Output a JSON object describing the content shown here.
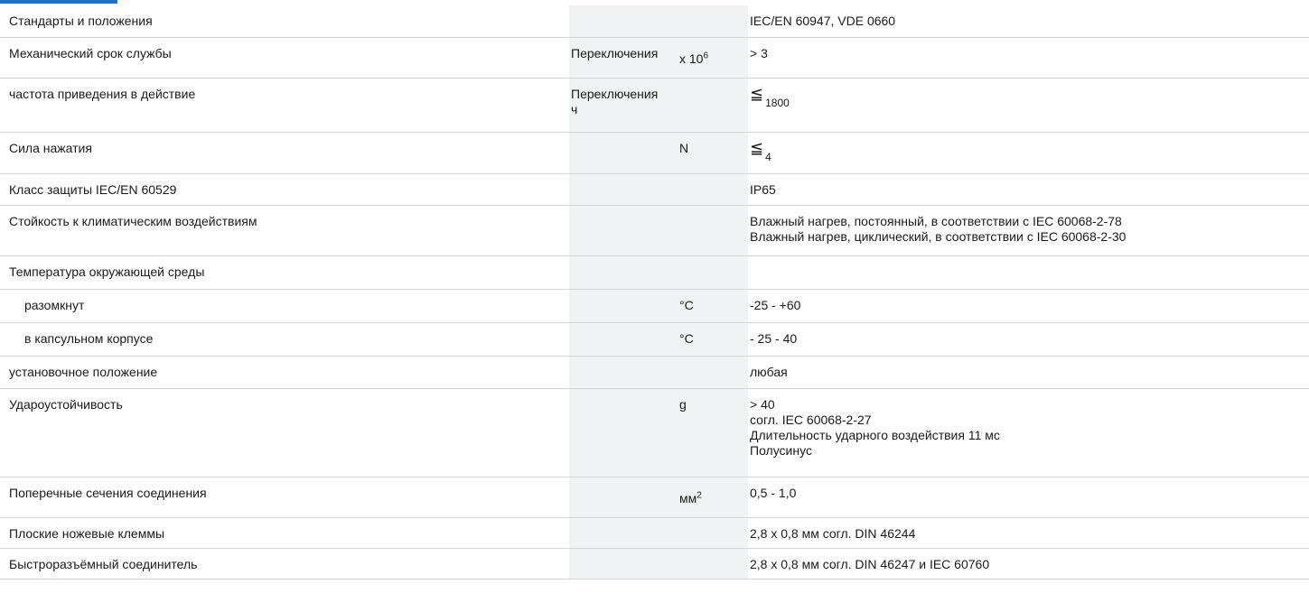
{
  "rows": [
    {
      "label": "Стандарты и положения",
      "value": "IEC/EN 60947, VDE 0660"
    },
    {
      "label": "Механический срок службы",
      "unit1": "Переключения",
      "unit2_base": "x 10",
      "unit2_exp": "6",
      "value": "> 3"
    },
    {
      "label": "частота приведения в действие",
      "unit1_a": "Переключения",
      "unit1_b": "ч",
      "value_symbol": "≦",
      "value": "1800"
    },
    {
      "label": "Сила нажатия",
      "unit2": "N",
      "value_symbol": "≦",
      "value": "4"
    },
    {
      "label": "Класс защиты IEC/EN 60529",
      "value": "IP65"
    },
    {
      "label": "Стойкость к климатическим воздействиям",
      "values": [
        "Влажный нагрев, постоянный, в соответствии с IEC 60068-2-78",
        "Влажный нагрев, циклический, в соответствии с IEC 60068-2-30"
      ]
    },
    {
      "label": "Температура окружающей среды"
    },
    {
      "label": "разомкнут",
      "unit2": "°C",
      "value": "-25 - +60"
    },
    {
      "label": "в капсульном корпусе",
      "unit2": "°C",
      "value": "- 25 - 40"
    },
    {
      "label": "установочное положение",
      "value": "любая"
    },
    {
      "label": "Удароустойчивость",
      "unit2": "g",
      "values": [
        "> 40",
        "согл. IEC 60068-2-27",
        "Длительность ударного воздействия 11 мс",
        "Полусинус"
      ]
    },
    {
      "label": "Поперечные сечения соединения",
      "unit2_base": "мм",
      "unit2_exp": "2",
      "value": "0,5 - 1,0"
    },
    {
      "label": "Плоские ножевые клеммы",
      "value": "2,8 x 0,8 мм согл. DIN 46244"
    },
    {
      "label": "Быстроразъёмный соединитель",
      "value": "2,8 x 0,8 мм согл. DIN 46247 и IEC 60760"
    }
  ]
}
